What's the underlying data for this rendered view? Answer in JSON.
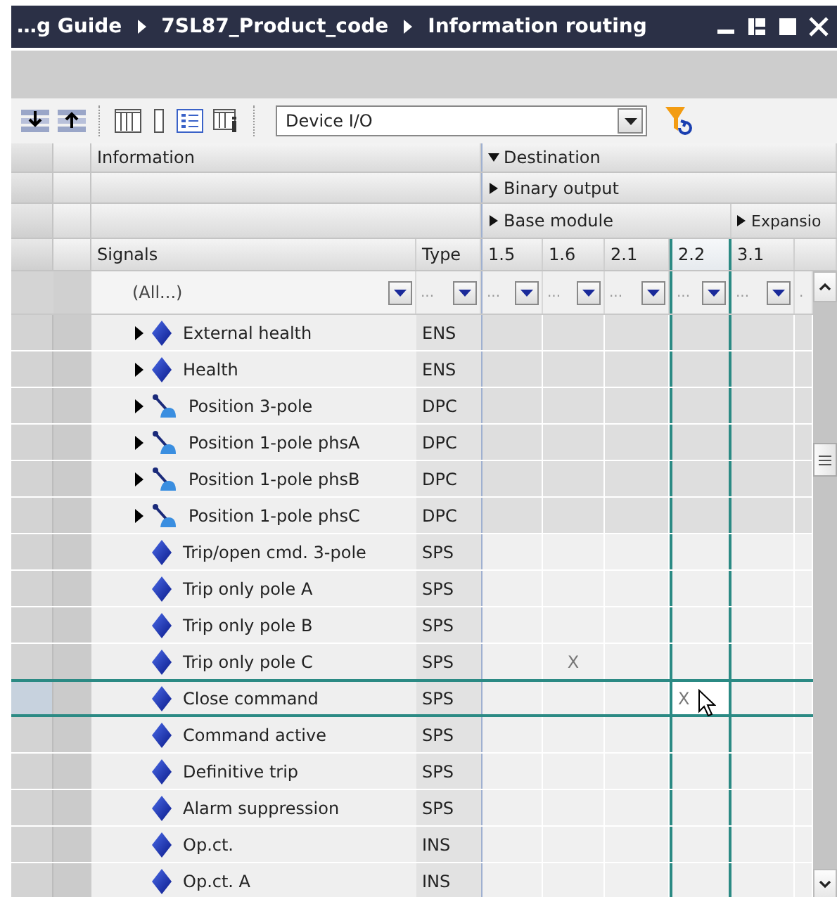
{
  "window": {
    "breadcrumb": [
      "…g Guide",
      "7SL87_Product_code",
      "Information routing"
    ]
  },
  "toolbar": {
    "view_select": {
      "value": "Device I/O"
    }
  },
  "table": {
    "header_groups": {
      "information": "Information",
      "destination": {
        "label": "Destination",
        "expanded": true
      },
      "binary_output": {
        "label": "Binary output",
        "expanded": false
      },
      "base_module": {
        "label": "Base module",
        "expanded": false
      },
      "expansion": {
        "label": "Expansio",
        "expanded": false
      }
    },
    "signals_header": "Signals",
    "type_header": "Type",
    "columns": [
      {
        "label": "1.5",
        "selected": false
      },
      {
        "label": "1.6",
        "selected": false
      },
      {
        "label": "2.1",
        "selected": false
      },
      {
        "label": "2.2",
        "selected": true
      },
      {
        "label": "3.1",
        "selected": false
      }
    ],
    "filter": {
      "signals": "(All...)",
      "type": "...",
      "columns": [
        "...",
        "...",
        "...",
        "...",
        "..."
      ],
      "partial": "."
    },
    "rows": [
      {
        "name": "External health",
        "type": "ENS",
        "kind": "status",
        "selected": false,
        "cells": [
          null,
          null,
          null,
          null,
          null
        ]
      },
      {
        "name": "Health",
        "type": "ENS",
        "kind": "status",
        "selected": false,
        "cells": [
          null,
          null,
          null,
          null,
          null
        ]
      },
      {
        "name": "Position 3-pole",
        "type": "DPC",
        "kind": "switch",
        "selected": false,
        "cells": [
          null,
          null,
          null,
          null,
          null
        ]
      },
      {
        "name": "Position 1-pole phsA",
        "type": "DPC",
        "kind": "switch",
        "selected": false,
        "cells": [
          null,
          null,
          null,
          null,
          null
        ]
      },
      {
        "name": "Position 1-pole phsB",
        "type": "DPC",
        "kind": "switch",
        "selected": false,
        "cells": [
          null,
          null,
          null,
          null,
          null
        ]
      },
      {
        "name": "Position 1-pole phsC",
        "type": "DPC",
        "kind": "switch",
        "selected": false,
        "cells": [
          null,
          null,
          null,
          null,
          null
        ]
      },
      {
        "name": "Trip/open cmd. 3-pole",
        "type": "SPS",
        "kind": "signal",
        "selected": false,
        "cells": [
          null,
          null,
          null,
          null,
          null
        ]
      },
      {
        "name": "Trip only pole A",
        "type": "SPS",
        "kind": "signal",
        "selected": false,
        "cells": [
          null,
          null,
          null,
          null,
          null
        ]
      },
      {
        "name": "Trip only pole B",
        "type": "SPS",
        "kind": "signal",
        "selected": false,
        "cells": [
          null,
          null,
          null,
          null,
          null
        ]
      },
      {
        "name": "Trip only pole C",
        "type": "SPS",
        "kind": "signal",
        "selected": false,
        "cells": [
          null,
          "X",
          null,
          null,
          null
        ]
      },
      {
        "name": "Close command",
        "type": "SPS",
        "kind": "signal",
        "selected": true,
        "cells": [
          null,
          null,
          null,
          "X",
          null
        ]
      },
      {
        "name": "Command active",
        "type": "SPS",
        "kind": "signal",
        "selected": false,
        "cells": [
          null,
          null,
          null,
          null,
          null
        ]
      },
      {
        "name": "Definitive trip",
        "type": "SPS",
        "kind": "signal",
        "selected": false,
        "cells": [
          null,
          null,
          null,
          null,
          null
        ]
      },
      {
        "name": "Alarm suppression",
        "type": "SPS",
        "kind": "signal",
        "selected": false,
        "cells": [
          null,
          null,
          null,
          null,
          null
        ]
      },
      {
        "name": "Op.ct.",
        "type": "INS",
        "kind": "signal",
        "selected": false,
        "cells": [
          null,
          null,
          null,
          null,
          null
        ]
      },
      {
        "name": "Op.ct. A",
        "type": "INS",
        "kind": "signal",
        "selected": false,
        "cells": [
          null,
          null,
          null,
          null,
          null
        ]
      }
    ]
  }
}
